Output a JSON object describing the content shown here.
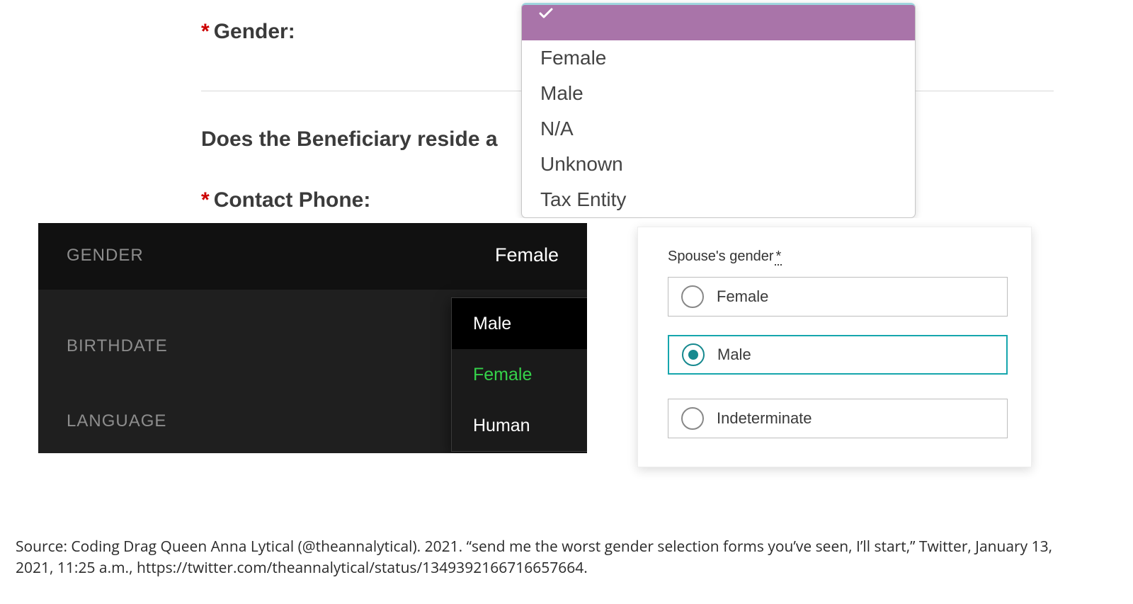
{
  "panel1": {
    "required_marker": "*",
    "gender_label": "Gender:",
    "beneficiary_question": "Does the Beneficiary reside a",
    "contact_phone_label": "Contact Phone:",
    "dropdown": {
      "selected_index": 0,
      "options": [
        "",
        "Female",
        "Male",
        "N/A",
        "Unknown",
        "Tax Entity"
      ]
    }
  },
  "panel2": {
    "rows": [
      {
        "label": "GENDER",
        "value": "Female"
      },
      {
        "label": "BIRTHDATE",
        "value": ""
      },
      {
        "label": "LANGUAGE",
        "value": ""
      }
    ],
    "flyout": {
      "items": [
        "Male",
        "Female",
        "Human"
      ],
      "highlighted_index": 0,
      "selected_index": 1
    }
  },
  "panel3": {
    "title": "Spouse's gender",
    "required_marker": "*",
    "options": [
      "Female",
      "Male",
      "Indeterminate"
    ],
    "selected_index": 1
  },
  "caption": "Source: Coding Drag Queen Anna Lytical (@theannalytical). 2021. “send me the worst gender selection forms you’ve seen, I’ll start,” Twitter, January 13, 2021, 11:25 a.m., https://twitter.com/theannalytical/status/1349392166716657664."
}
